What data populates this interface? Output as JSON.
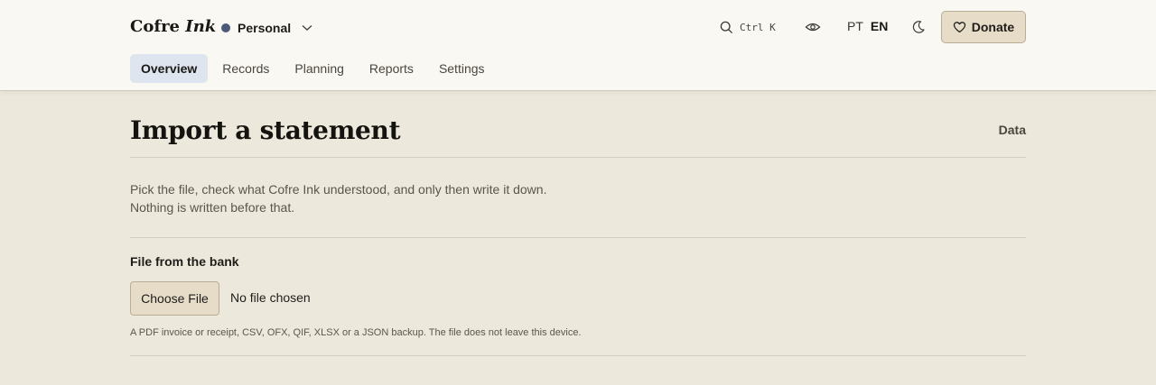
{
  "brand": {
    "name": "Cofre",
    "accent": "Ink"
  },
  "profile": {
    "name": "Personal",
    "color": "#4a5a78"
  },
  "search": {
    "shortcut": "Ctrl K"
  },
  "languages": {
    "inactive": "PT",
    "active": "EN"
  },
  "donate": {
    "label": "Donate"
  },
  "nav": {
    "tabs": [
      {
        "label": "Overview",
        "active": true
      },
      {
        "label": "Records"
      },
      {
        "label": "Planning"
      },
      {
        "label": "Reports"
      },
      {
        "label": "Settings"
      }
    ]
  },
  "page": {
    "title": "Import a statement",
    "section": "Data",
    "intro_line1": "Pick the file, check what Cofre Ink understood, and only then write it down.",
    "intro_line2": "Nothing is written before that."
  },
  "upload": {
    "label": "File from the bank",
    "button_label": "Choose File",
    "status": "No file chosen",
    "hint": "A PDF invoice or receipt, CSV, OFX, QIF, XLSX or a JSON backup. The file does not leave this device."
  },
  "colors": {
    "background": "#ede8dc",
    "header": "#faf8f3",
    "active_tab": "#dfe5ee",
    "button": "#e6dcc8"
  }
}
